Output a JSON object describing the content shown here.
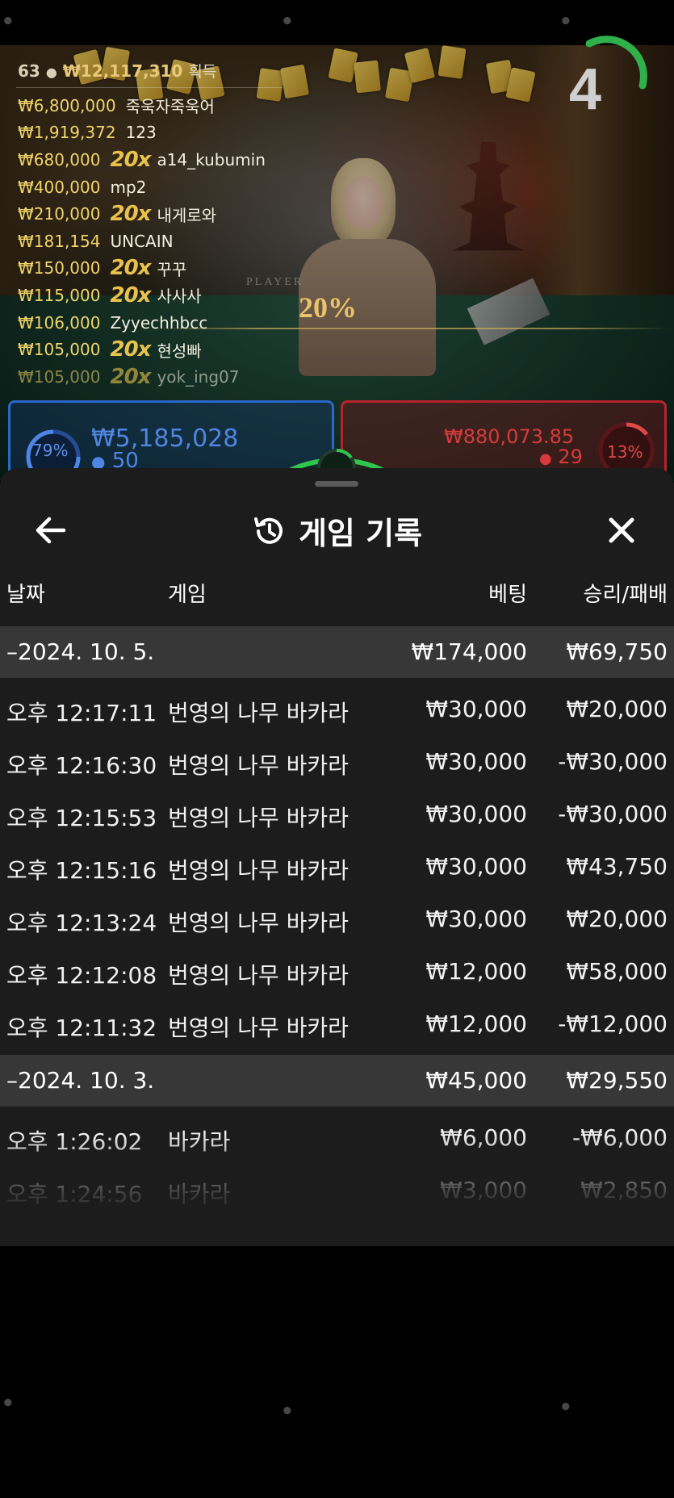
{
  "stream": {
    "stats": {
      "players": "63",
      "total_won": "₩12,117,310",
      "won_label": "획득"
    },
    "winners": [
      {
        "amount": "₩6,800,000",
        "multiplier": "",
        "name": "죽욱자죽욱어"
      },
      {
        "amount": "₩1,919,372",
        "multiplier": "",
        "name": "123"
      },
      {
        "amount": "₩680,000",
        "multiplier": "20x",
        "name": "a14_kubumin"
      },
      {
        "amount": "₩400,000",
        "multiplier": "",
        "name": "mp2"
      },
      {
        "amount": "₩210,000",
        "multiplier": "20x",
        "name": "내게로와"
      },
      {
        "amount": "₩181,154",
        "multiplier": "",
        "name": "UNCAIN"
      },
      {
        "amount": "₩150,000",
        "multiplier": "20x",
        "name": "꾸꾸"
      },
      {
        "amount": "₩115,000",
        "multiplier": "20x",
        "name": "사사사"
      },
      {
        "amount": "₩106,000",
        "multiplier": "",
        "name": "Zyyechhbcc"
      },
      {
        "amount": "₩105,000",
        "multiplier": "20x",
        "name": "현성빠"
      },
      {
        "amount": "₩105,000",
        "multiplier": "20x",
        "name": "yok_ing07"
      }
    ],
    "timer": "4",
    "player_label": "PLAYER",
    "banner_percent": "20%",
    "player_bet": {
      "percent": "79%",
      "amount": "₩5,185,028",
      "count": "50",
      "color": "#2967c9"
    },
    "banker_bet": {
      "percent": "13%",
      "amount": "₩880,073.85",
      "count": "29",
      "color": "#b8232a"
    }
  },
  "panel": {
    "title": "게임 기록",
    "back_icon": "arrow-left-icon",
    "history_icon": "history-clock-icon",
    "close_icon": "close-icon",
    "columns": {
      "date": "날짜",
      "game": "게임",
      "bet": "베팅",
      "result": "승리/패배"
    },
    "groups": [
      {
        "date": "–2024. 10. 5.",
        "bet": "₩174,000",
        "result": "₩69,750",
        "rows": [
          {
            "time": "오후 12:17:11",
            "game": "번영의 나무 바카라",
            "bet": "₩30,000",
            "result": "₩20,000"
          },
          {
            "time": "오후 12:16:30",
            "game": "번영의 나무 바카라",
            "bet": "₩30,000",
            "result": "-₩30,000"
          },
          {
            "time": "오후 12:15:53",
            "game": "번영의 나무 바카라",
            "bet": "₩30,000",
            "result": "-₩30,000"
          },
          {
            "time": "오후 12:15:16",
            "game": "번영의 나무 바카라",
            "bet": "₩30,000",
            "result": "₩43,750"
          },
          {
            "time": "오후 12:13:24",
            "game": "번영의 나무 바카라",
            "bet": "₩30,000",
            "result": "₩20,000"
          },
          {
            "time": "오후 12:12:08",
            "game": "번영의 나무 바카라",
            "bet": "₩12,000",
            "result": "₩58,000"
          },
          {
            "time": "오후 12:11:32",
            "game": "번영의 나무 바카라",
            "bet": "₩12,000",
            "result": "-₩12,000"
          }
        ]
      },
      {
        "date": "–2024. 10. 3.",
        "bet": "₩45,000",
        "result": "₩29,550",
        "rows": [
          {
            "time": "오후 1:26:02",
            "game": "바카라",
            "bet": "₩6,000",
            "result": "-₩6,000"
          },
          {
            "time": "오후 1:24:56",
            "game": "바카라",
            "bet": "₩3,000",
            "result": "₩2,850"
          }
        ]
      }
    ]
  },
  "colors": {
    "panel_bg": "#1c1c1c",
    "group_bg": "#373737",
    "accent_gold": "#f0d46a"
  }
}
